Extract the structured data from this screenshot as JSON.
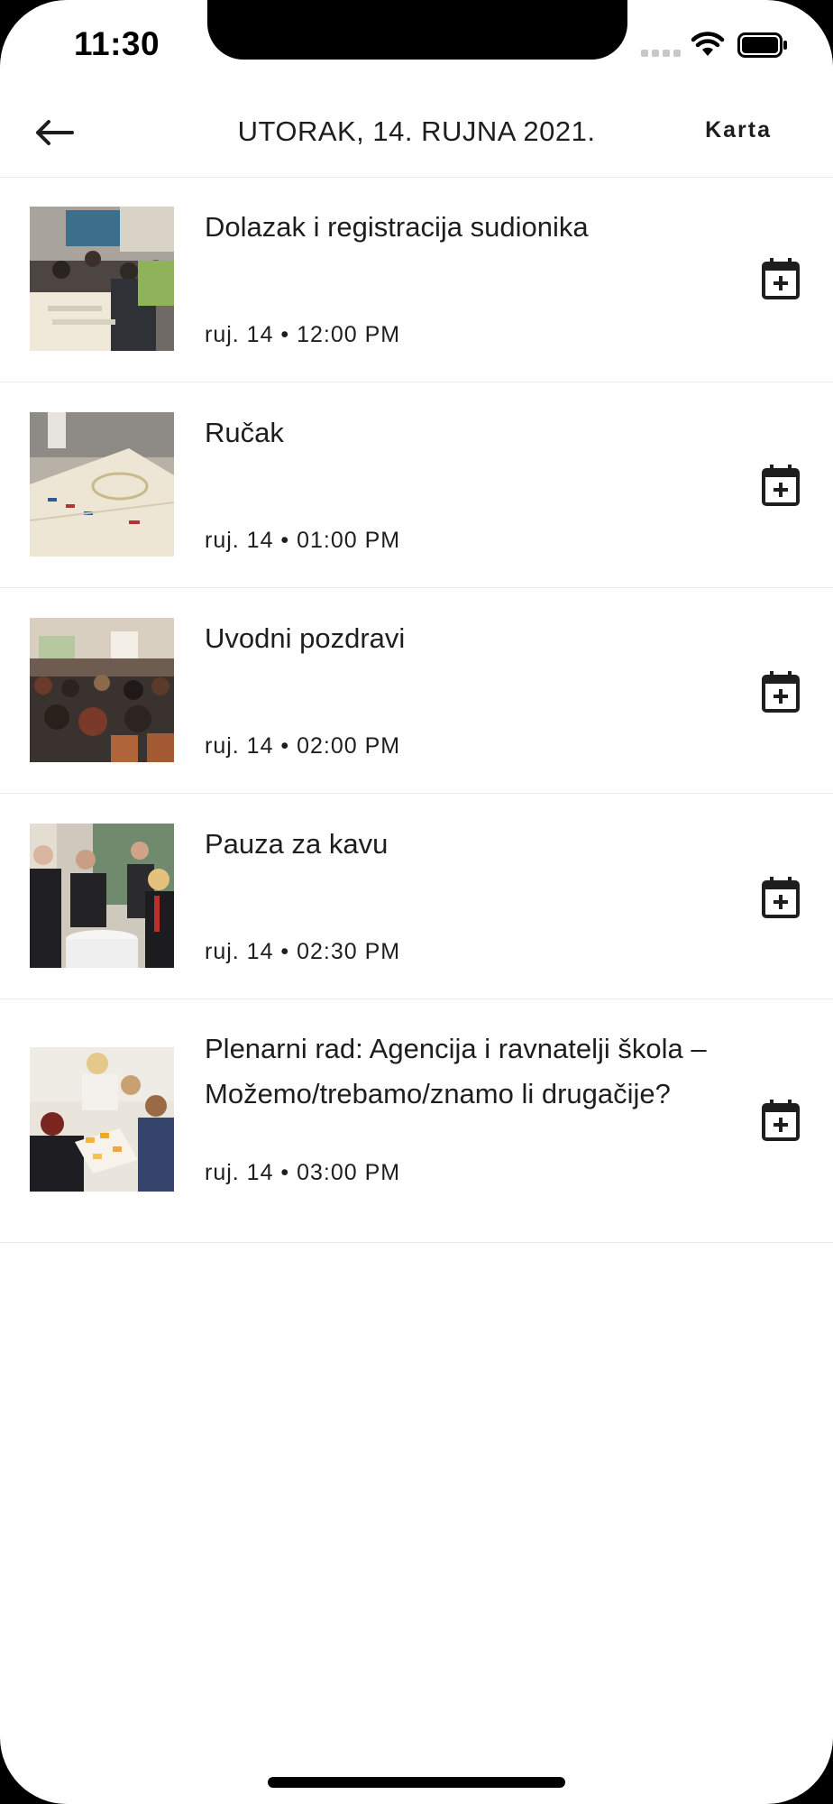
{
  "status_bar": {
    "time": "11:30"
  },
  "header": {
    "back_icon": "arrow-left-icon",
    "title": "UTORAK, 14. RUJNA 2021.",
    "map_label": "Karta"
  },
  "events": [
    {
      "title": "Dolazak i registracija sudionika",
      "time": "ruj. 14 • 12:00 PM",
      "thumbnail": "registration-photo",
      "action_icon": "calendar-plus-icon"
    },
    {
      "title": "Ručak",
      "time": "ruj. 14 • 01:00 PM",
      "thumbnail": "lunch-table-photo",
      "action_icon": "calendar-plus-icon"
    },
    {
      "title": "Uvodni pozdravi",
      "time": "ruj. 14 • 02:00 PM",
      "thumbnail": "audience-hall-photo",
      "action_icon": "calendar-plus-icon"
    },
    {
      "title": "Pauza za kavu",
      "time": "ruj. 14 • 02:30 PM",
      "thumbnail": "coffee-break-photo",
      "action_icon": "calendar-plus-icon"
    },
    {
      "title": "Plenarni rad: Agencija i ravnatelji škola – Možemo/trebamo/znamo li drugačije?",
      "time": "ruj. 14 • 03:00 PM",
      "thumbnail": "workshop-photo",
      "action_icon": "calendar-plus-icon"
    }
  ],
  "colors": {
    "background": "#ffffff",
    "text": "#1e1e1e",
    "divider": "#ececec"
  }
}
